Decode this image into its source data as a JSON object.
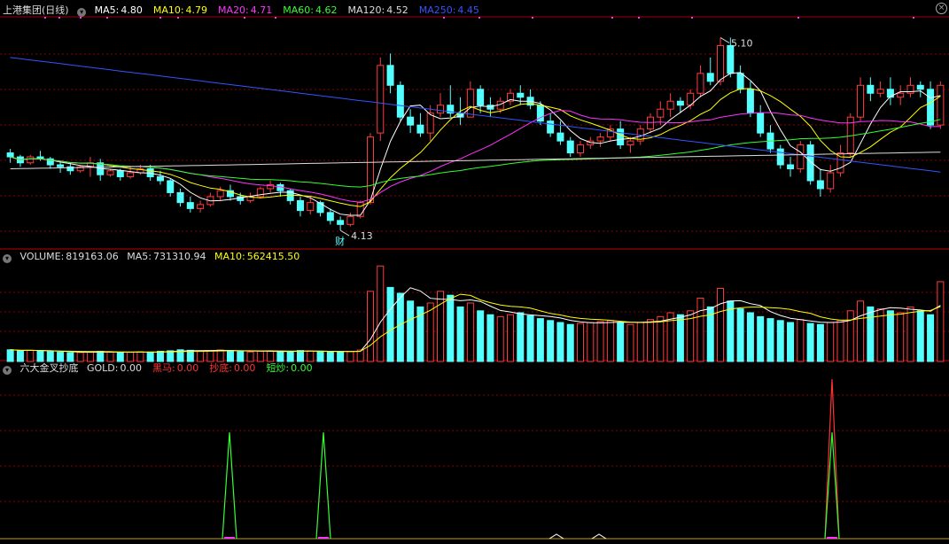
{
  "price_panel": {
    "title": "上港集团(日线)",
    "ma": [
      {
        "label": "MA5:",
        "value": "4.80",
        "color": "#ffffff"
      },
      {
        "label": "MA10:",
        "value": "4.79",
        "color": "#ffff00"
      },
      {
        "label": "MA20:",
        "value": "4.71",
        "color": "#ff33ff"
      },
      {
        "label": "MA60:",
        "value": "4.62",
        "color": "#33ff33"
      },
      {
        "label": "MA120:",
        "value": "4.52",
        "color": "#dddddd"
      },
      {
        "label": "MA250:",
        "value": "4.45",
        "color": "#3355ff"
      }
    ],
    "high_label": "5.10",
    "low_label": "4.13",
    "marker_text": "财"
  },
  "volume_panel": {
    "title": "VOLUME:",
    "value": "819163.06",
    "ma5_label": "MA5:",
    "ma5_value": "731310.94",
    "ma10_label": "MA10:",
    "ma10_value": "562415.50"
  },
  "indicator_panel": {
    "title": "六大金叉抄底",
    "items": [
      {
        "label": "GOLD:",
        "value": "0.00",
        "color": "#dddddd"
      },
      {
        "label": "黑马:",
        "value": "0.00",
        "color": "#ff3333"
      },
      {
        "label": "抄底:",
        "value": "0.00",
        "color": "#ff3333"
      },
      {
        "label": "短炒:",
        "value": "0.00",
        "color": "#33ff33"
      }
    ]
  },
  "colors": {
    "up": "#ff3c3c",
    "down": "#54ffff",
    "grid": "#8b0000"
  },
  "chart_data": {
    "type": "candlestick",
    "price_range": [
      4.05,
      5.2
    ],
    "highlights": {
      "high": 5.1,
      "low": 4.13
    },
    "ohlc": [
      [
        4.52,
        4.54,
        4.47,
        4.5
      ],
      [
        4.5,
        4.51,
        4.45,
        4.47
      ],
      [
        4.47,
        4.51,
        4.46,
        4.5
      ],
      [
        4.5,
        4.53,
        4.48,
        4.49
      ],
      [
        4.49,
        4.5,
        4.44,
        4.46
      ],
      [
        4.46,
        4.48,
        4.42,
        4.45
      ],
      [
        4.45,
        4.47,
        4.41,
        4.43
      ],
      [
        4.43,
        4.46,
        4.42,
        4.45
      ],
      [
        4.45,
        4.5,
        4.4,
        4.47
      ],
      [
        4.47,
        4.49,
        4.38,
        4.41
      ],
      [
        4.41,
        4.44,
        4.4,
        4.43
      ],
      [
        4.43,
        4.44,
        4.38,
        4.4
      ],
      [
        4.4,
        4.45,
        4.39,
        4.42
      ],
      [
        4.42,
        4.46,
        4.41,
        4.44
      ],
      [
        4.44,
        4.46,
        4.38,
        4.4
      ],
      [
        4.4,
        4.43,
        4.36,
        4.38
      ],
      [
        4.38,
        4.39,
        4.3,
        4.32
      ],
      [
        4.32,
        4.34,
        4.25,
        4.27
      ],
      [
        4.27,
        4.3,
        4.22,
        4.24
      ],
      [
        4.24,
        4.28,
        4.22,
        4.26
      ],
      [
        4.26,
        4.32,
        4.25,
        4.3
      ],
      [
        4.3,
        4.35,
        4.28,
        4.33
      ],
      [
        4.33,
        4.36,
        4.28,
        4.3
      ],
      [
        4.3,
        4.32,
        4.26,
        4.28
      ],
      [
        4.28,
        4.32,
        4.27,
        4.3
      ],
      [
        4.3,
        4.35,
        4.29,
        4.34
      ],
      [
        4.34,
        4.38,
        4.32,
        4.36
      ],
      [
        4.36,
        4.37,
        4.3,
        4.33
      ],
      [
        4.33,
        4.34,
        4.26,
        4.28
      ],
      [
        4.28,
        4.3,
        4.2,
        4.23
      ],
      [
        4.23,
        4.3,
        4.21,
        4.27
      ],
      [
        4.27,
        4.28,
        4.2,
        4.22
      ],
      [
        4.22,
        4.24,
        4.16,
        4.18
      ],
      [
        4.18,
        4.2,
        4.13,
        4.16
      ],
      [
        4.16,
        4.22,
        4.15,
        4.2
      ],
      [
        4.2,
        4.28,
        4.19,
        4.27
      ],
      [
        4.27,
        4.62,
        4.26,
        4.6
      ],
      [
        4.62,
        5.0,
        4.58,
        4.96
      ],
      [
        4.96,
        5.02,
        4.82,
        4.86
      ],
      [
        4.86,
        4.88,
        4.68,
        4.7
      ],
      [
        4.7,
        4.74,
        4.62,
        4.66
      ],
      [
        4.66,
        4.72,
        4.6,
        4.62
      ],
      [
        4.62,
        4.76,
        4.58,
        4.72
      ],
      [
        4.72,
        4.82,
        4.7,
        4.76
      ],
      [
        4.76,
        4.86,
        4.7,
        4.72
      ],
      [
        4.72,
        4.8,
        4.66,
        4.7
      ],
      [
        4.7,
        4.88,
        4.7,
        4.84
      ],
      [
        4.84,
        4.86,
        4.72,
        4.76
      ],
      [
        4.76,
        4.8,
        4.7,
        4.74
      ],
      [
        4.74,
        4.8,
        4.72,
        4.78
      ],
      [
        4.78,
        4.84,
        4.76,
        4.82
      ],
      [
        4.82,
        4.86,
        4.76,
        4.8
      ],
      [
        4.8,
        4.84,
        4.74,
        4.76
      ],
      [
        4.76,
        4.78,
        4.66,
        4.68
      ],
      [
        4.68,
        4.72,
        4.6,
        4.62
      ],
      [
        4.62,
        4.68,
        4.56,
        4.58
      ],
      [
        4.58,
        4.6,
        4.5,
        4.52
      ],
      [
        4.52,
        4.58,
        4.5,
        4.56
      ],
      [
        4.56,
        4.6,
        4.54,
        4.58
      ],
      [
        4.58,
        4.62,
        4.55,
        4.6
      ],
      [
        4.6,
        4.66,
        4.58,
        4.64
      ],
      [
        4.64,
        4.68,
        4.54,
        4.56
      ],
      [
        4.56,
        4.6,
        4.52,
        4.58
      ],
      [
        4.58,
        4.66,
        4.56,
        4.64
      ],
      [
        4.64,
        4.72,
        4.62,
        4.7
      ],
      [
        4.7,
        4.78,
        4.66,
        4.74
      ],
      [
        4.74,
        4.82,
        4.7,
        4.78
      ],
      [
        4.78,
        4.8,
        4.72,
        4.76
      ],
      [
        4.76,
        4.84,
        4.74,
        4.82
      ],
      [
        4.82,
        4.96,
        4.8,
        4.92
      ],
      [
        4.92,
        5.0,
        4.86,
        4.88
      ],
      [
        4.88,
        5.1,
        4.86,
        5.06
      ],
      [
        5.06,
        5.1,
        4.9,
        4.92
      ],
      [
        4.92,
        4.96,
        4.82,
        4.84
      ],
      [
        4.84,
        4.88,
        4.7,
        4.72
      ],
      [
        4.72,
        4.76,
        4.6,
        4.62
      ],
      [
        4.62,
        4.66,
        4.52,
        4.54
      ],
      [
        4.54,
        4.56,
        4.44,
        4.46
      ],
      [
        4.46,
        4.5,
        4.4,
        4.44
      ],
      [
        4.44,
        4.58,
        4.42,
        4.56
      ],
      [
        4.56,
        4.58,
        4.36,
        4.38
      ],
      [
        4.38,
        4.44,
        4.3,
        4.34
      ],
      [
        4.34,
        4.46,
        4.32,
        4.42
      ],
      [
        4.42,
        4.56,
        4.4,
        4.52
      ],
      [
        4.52,
        4.72,
        4.5,
        4.7
      ],
      [
        4.7,
        4.9,
        4.68,
        4.86
      ],
      [
        4.86,
        4.9,
        4.78,
        4.82
      ],
      [
        4.82,
        4.88,
        4.8,
        4.84
      ],
      [
        4.84,
        4.9,
        4.76,
        4.8
      ],
      [
        4.8,
        4.86,
        4.76,
        4.82
      ],
      [
        4.82,
        4.9,
        4.8,
        4.86
      ],
      [
        4.86,
        4.88,
        4.8,
        4.84
      ],
      [
        4.84,
        4.88,
        4.64,
        4.66
      ],
      [
        4.66,
        4.88,
        4.64,
        4.86
      ]
    ],
    "volume": [
      120,
      110,
      115,
      105,
      100,
      95,
      90,
      92,
      98,
      105,
      96,
      90,
      94,
      100,
      98,
      105,
      110,
      120,
      115,
      108,
      110,
      118,
      112,
      100,
      98,
      104,
      110,
      106,
      100,
      112,
      108,
      104,
      98,
      96,
      102,
      118,
      720,
      980,
      760,
      700,
      620,
      560,
      600,
      720,
      680,
      560,
      600,
      520,
      480,
      460,
      480,
      500,
      470,
      440,
      420,
      400,
      380,
      390,
      400,
      410,
      420,
      400,
      380,
      400,
      430,
      460,
      500,
      480,
      520,
      650,
      560,
      750,
      620,
      540,
      500,
      460,
      440,
      420,
      400,
      430,
      390,
      380,
      400,
      420,
      520,
      620,
      560,
      540,
      520,
      500,
      560,
      520,
      480,
      819
    ]
  }
}
